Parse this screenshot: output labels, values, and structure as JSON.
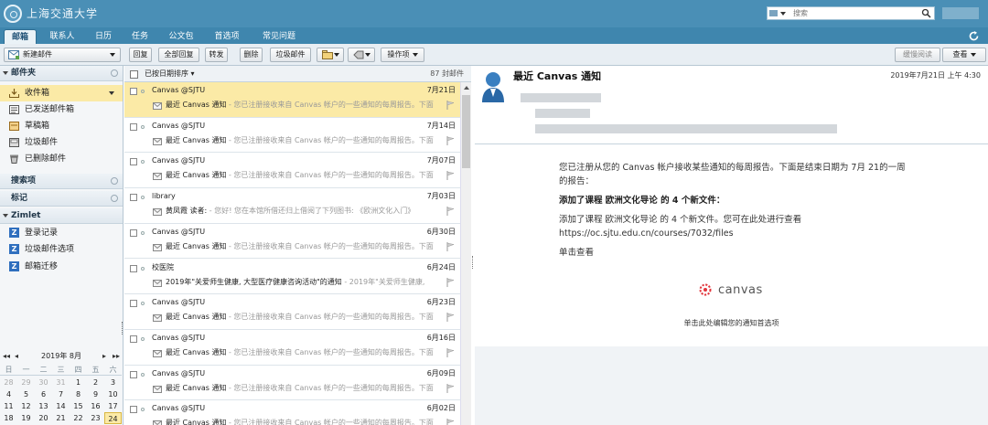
{
  "app": {
    "logo_text": "上海交通大学"
  },
  "search": {
    "placeholder": "搜索",
    "scope": "邮件"
  },
  "tabs": [
    {
      "label": "邮箱"
    },
    {
      "label": "联系人"
    },
    {
      "label": "日历"
    },
    {
      "label": "任务"
    },
    {
      "label": "公文包"
    },
    {
      "label": "首选项"
    },
    {
      "label": "常见问题"
    }
  ],
  "toolbar": {
    "new_mail": "新建邮件",
    "reply": "回复",
    "reply_all": "全部回复",
    "forward": "转发",
    "delete": "删除",
    "junk": "垃圾邮件",
    "actions": "操作项",
    "print_preview": "缓慢阅读",
    "view": "查看"
  },
  "sidebar": {
    "folders_title": "邮件夹",
    "folders": [
      {
        "label": "收件箱",
        "icon": "inbox-icon"
      },
      {
        "label": "已发送邮件箱",
        "icon": "sent-icon"
      },
      {
        "label": "草稿箱",
        "icon": "drafts-icon"
      },
      {
        "label": "垃圾邮件",
        "icon": "junk-icon"
      },
      {
        "label": "已删除邮件",
        "icon": "trash-icon"
      }
    ],
    "searches_title": "搜索项",
    "tags_title": "标记",
    "zimlet_title": "Zimlet",
    "zimlets": [
      {
        "label": "登录记录"
      },
      {
        "label": "垃圾邮件选项"
      },
      {
        "label": "邮箱迁移"
      }
    ]
  },
  "calendar": {
    "title": "2019年 8月",
    "weekdays": [
      "日",
      "一",
      "二",
      "三",
      "四",
      "五",
      "六"
    ],
    "weeks": [
      [
        "28",
        "29",
        "30",
        "31",
        "1",
        "2",
        "3"
      ],
      [
        "4",
        "5",
        "6",
        "7",
        "8",
        "9",
        "10"
      ],
      [
        "11",
        "12",
        "13",
        "14",
        "15",
        "16",
        "17"
      ],
      [
        "18",
        "19",
        "20",
        "21",
        "22",
        "23",
        "24"
      ]
    ],
    "today": "24"
  },
  "list": {
    "sort_label": "已按日期排序",
    "count": "87 封邮件",
    "messages": [
      {
        "sender": "Canvas @SJTU",
        "date": "7月21日",
        "subject": "最近 Canvas 通知",
        "snippet": " - 您已注册接收来自 Canvas 帐户的一些通知的每周报告。下面",
        "selected": true
      },
      {
        "sender": "Canvas @SJTU",
        "date": "7月14日",
        "subject": "最近 Canvas 通知",
        "snippet": " - 您已注册接收来自 Canvas 帐户的一些通知的每周报告。下面",
        "selected": false
      },
      {
        "sender": "Canvas @SJTU",
        "date": "7月07日",
        "subject": "最近 Canvas 通知",
        "snippet": " - 您已注册接收来自 Canvas 帐户的一些通知的每周报告。下面",
        "selected": false
      },
      {
        "sender": "library",
        "date": "7月03日",
        "subject": "黄凤霞 读者:",
        "snippet": " - 您好! 您在本馆所借还归上借阅了下列图书: 《欧洲文化入门》",
        "selected": false
      },
      {
        "sender": "Canvas @SJTU",
        "date": "6月30日",
        "subject": "最近 Canvas 通知",
        "snippet": " - 您已注册接收来自 Canvas 帐户的一些通知的每周报告。下面",
        "selected": false
      },
      {
        "sender": "校医院",
        "date": "6月24日",
        "subject": "2019年\"关爱师生健康, 大型医疗健康咨询活动\"的通知",
        "snippet": " - 2019年\"关爱师生健康, ",
        "selected": false
      },
      {
        "sender": "Canvas @SJTU",
        "date": "6月23日",
        "subject": "最近 Canvas 通知",
        "snippet": " - 您已注册接收来自 Canvas 帐户的一些通知的每周报告。下面",
        "selected": false
      },
      {
        "sender": "Canvas @SJTU",
        "date": "6月16日",
        "subject": "最近 Canvas 通知",
        "snippet": " - 您已注册接收来自 Canvas 帐户的一些通知的每周报告。下面",
        "selected": false
      },
      {
        "sender": "Canvas @SJTU",
        "date": "6月09日",
        "subject": "最近 Canvas 通知",
        "snippet": " - 您已注册接收来自 Canvas 帐户的一些通知的每周报告。下面",
        "selected": false
      },
      {
        "sender": "Canvas @SJTU",
        "date": "6月02日",
        "subject": "最近 Canvas 通知",
        "snippet": " - 您已注册接收来自 Canvas 帐户的一些通知的每周报告。下面",
        "selected": false
      }
    ]
  },
  "reader": {
    "subject": "最近 Canvas 通知",
    "date": "2019年7月21日 上午 4:30",
    "body_p1": "您已注册从您的 Canvas 帐户接收某些通知的每周报告。下面是结束日期为 7月 21的一周的报告：",
    "body_p2": "添加了课程 欧洲文化导论 的 4 个新文件：",
    "body_p3": "添加了课程 欧洲文化导论 的 4 个新文件。您可在此处进行查看 https://oc.sjtu.edu.cn/courses/7032/files",
    "view_link": "单击查看",
    "brand": "canvas",
    "prefs_link": "单击此处编辑您的通知首选项"
  },
  "colors": {
    "header": "#4a8fb6",
    "tabbar": "#3f86ae",
    "selected_row": "#fbeaa6",
    "canvas_red": "#e2333a"
  }
}
